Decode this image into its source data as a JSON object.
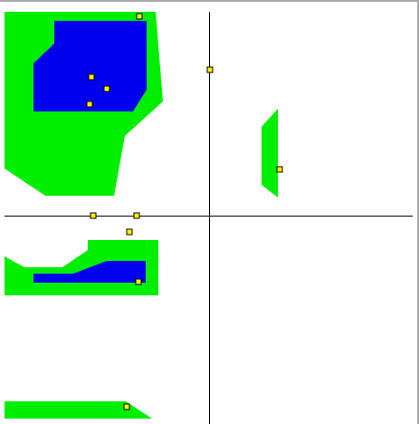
{
  "canvas": {
    "background": "#ffffff",
    "border_color": "#a9a9a9",
    "axis_color": "#000000"
  },
  "region_colors": {
    "outer": "#00ee00",
    "inner": "#0000ee"
  },
  "handle_style": {
    "fill": "#ffee00",
    "stroke": "#000000"
  },
  "regions": [
    {
      "name": "region-top-left-outer",
      "kind": "outer"
    },
    {
      "name": "region-top-left-inner",
      "kind": "inner"
    },
    {
      "name": "region-right-sliver-outer",
      "kind": "outer"
    },
    {
      "name": "region-middle-left-outer",
      "kind": "outer"
    },
    {
      "name": "region-middle-left-inner",
      "kind": "inner"
    },
    {
      "name": "region-bottom-left-outer",
      "kind": "outer"
    }
  ],
  "handles": [
    {
      "name": "handle-top-edge"
    },
    {
      "name": "handle-y-axis"
    },
    {
      "name": "handle-inner-1"
    },
    {
      "name": "handle-inner-2"
    },
    {
      "name": "handle-inner-3"
    },
    {
      "name": "handle-right-sliver"
    },
    {
      "name": "handle-x-axis-1"
    },
    {
      "name": "handle-x-axis-2"
    },
    {
      "name": "handle-below-axis"
    },
    {
      "name": "handle-middle-left"
    },
    {
      "name": "handle-bottom"
    }
  ]
}
